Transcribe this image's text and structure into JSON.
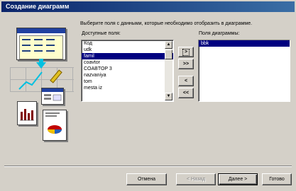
{
  "window": {
    "title": "Создание диаграмм"
  },
  "instruction": "Выберите поля с данными, которые необходимо отобразить в диаграмме.",
  "available": {
    "label": "Доступные поля:",
    "items": [
      "Код",
      "udk",
      "famil",
      "coavtor",
      "COABTOP 3",
      "nazvaniya",
      "tom",
      "mesta iz"
    ],
    "selected_index": 2
  },
  "chart_fields": {
    "label": "Поля диаграммы:",
    "items": [
      "bbk"
    ],
    "selected_index": 0
  },
  "move_buttons": {
    "add_one": ">",
    "add_all": ">>",
    "remove_one": "<",
    "remove_all": "<<"
  },
  "footer": {
    "cancel": "Отмена",
    "back": "< Назад",
    "next": "Далее >",
    "finish": "Готово"
  }
}
